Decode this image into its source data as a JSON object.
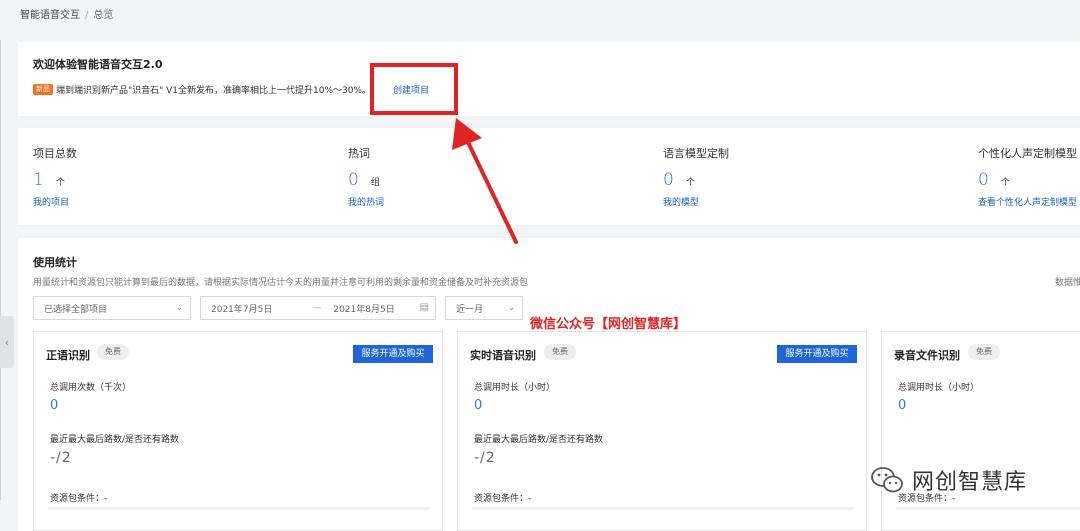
{
  "breadcrumb": {
    "root": "智能语音交互",
    "sep": "/",
    "current": "总览"
  },
  "welcome": {
    "title": "欢迎体验智能语音交互2.0",
    "badge": "新品",
    "news_text": "端到端识别新产品\"识音石\" V1全新发布，准确率相比上一代提升10%～30%。",
    "create_link": "创建项目"
  },
  "stats": [
    {
      "label": "项目总数",
      "value": "1",
      "unit": "个",
      "link": "我的项目"
    },
    {
      "label": "热词",
      "value": "0",
      "unit": "组",
      "link": "我的热词"
    },
    {
      "label": "语言模型定制",
      "value": "0",
      "unit": "个",
      "link": "我的模型"
    },
    {
      "label": "个性化人声定制模型",
      "value": "0",
      "unit": "个",
      "link": "查看个性化人声定制模型"
    }
  ],
  "usage": {
    "title": "使用统计",
    "desc": "用量统计和资源包只能计算到最后的数据，请根据实际情况估计今天的用量并注意可利用的剩余量和资金储备及时补充资源包",
    "right_note": "数据惟",
    "project_select": "已选择全部项目",
    "date_start": "2021年7月5日",
    "date_sep": "—",
    "date_end": "2021年8月5日",
    "range_select": "近一月"
  },
  "services": [
    {
      "name": "正语识别",
      "tag": "免费",
      "buy": "服务开通及购买",
      "metric1": "总调用次数（千次）",
      "value1": "0",
      "metric2": "最近最大最后路数/是否还有路数",
      "value2": "-/2",
      "metric3": "资源包条件：-"
    },
    {
      "name": "实时语音识别",
      "tag": "免费",
      "buy": "服务开通及购买",
      "metric1": "总调用时长（小时）",
      "value1": "0",
      "metric2": "最近最大最后路数/是否还有路数",
      "value2": "-/2",
      "metric3": "资源包条件：-"
    },
    {
      "name": "录音文件识别",
      "tag": "免费",
      "metric1": "总调用时长（小时）",
      "value1": "0",
      "metric3": "资源包条件：-"
    }
  ],
  "watermark": {
    "red_text": "微信公众号【网创智慧库】",
    "brand": "网创智慧库"
  },
  "colors": {
    "accent": "#2e78d6",
    "link": "#1b5fc6",
    "button": "#1f64d8",
    "annotation": "#e02323",
    "badge": "#f4711d"
  },
  "icons": {
    "calendar": "calendar-icon",
    "chevron": "chevron-down-icon",
    "collapse": "chevron-left-icon",
    "brand_logo": "wechat-logo-icon"
  }
}
